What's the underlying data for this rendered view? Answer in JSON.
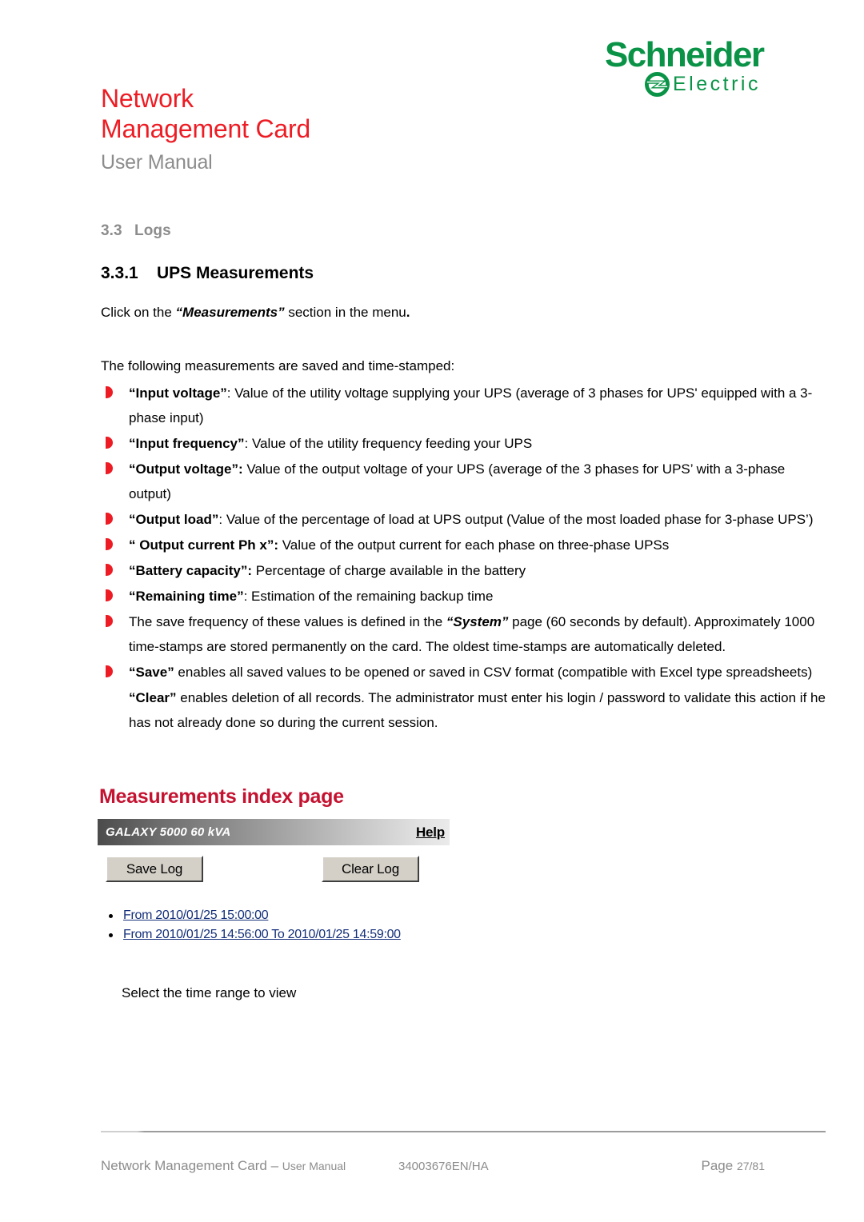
{
  "header": {
    "title_line1": "Network",
    "title_line2": "Management Card",
    "subtitle": "User Manual",
    "logo": {
      "wordmark": "Schneider",
      "subword": "Electric",
      "green": "#0A9347"
    },
    "title_color": "#ED1C24",
    "subtitle_color": "#8C8C8C"
  },
  "section": {
    "h2_number": "3.3",
    "h2_label": "Logs",
    "h3_number": "3.3.1",
    "h3_label": "UPS Measurements",
    "click_prefix": "Click on the ",
    "click_emphasis": "“Measurements”",
    "click_suffix": " section in the menu",
    "click_period": ".",
    "intro": "The following measurements are saved and time-stamped:"
  },
  "bullets": [
    {
      "bold": "“Input voltage”",
      "rest": ": Value of the utility voltage supplying your UPS (average of 3 phases for UPS' equipped with a 3-phase input)"
    },
    {
      "bold": "“Input frequency”",
      "rest": ": Value of the utility frequency feeding your UPS"
    },
    {
      "bold": "“Output voltage”:",
      "rest": " Value of the output voltage of your UPS (average of the 3 phases for UPS’ with a 3-phase output)"
    },
    {
      "bold": "“Output load”",
      "rest": ": Value of the percentage of load at UPS output (Value of the most loaded phase for 3-phase UPS’)"
    },
    {
      "bold": "“ Output current Ph x”:",
      "rest": " Value of the output current for each phase on three-phase UPSs"
    },
    {
      "bold": "“Battery capacity”:",
      "rest": " Percentage of charge available in the battery"
    },
    {
      "bold": "“Remaining time”",
      "rest": ": Estimation of the remaining backup time"
    }
  ],
  "system_bullet": {
    "pre": "The save frequency of these values is defined in the ",
    "emphasis": "“System”",
    "post": " page (60 seconds by default). Approximately 1000 time-stamps are stored permanently on the card. The oldest time-stamps are automatically deleted."
  },
  "save_bullet": {
    "bold": "“Save”",
    "rest": " enables all saved values to be opened or saved in CSV format (compatible with Excel type spreadsheets)"
  },
  "clear_paragraph": {
    "bold": "“Clear”",
    "rest": " enables deletion of all records. The administrator must enter his login / password to validate this action if he has not already done so during the current session."
  },
  "screenshot": {
    "title": "Measurements index page",
    "model": "GALAXY 5000 60 kVA",
    "help_label": "Help",
    "save_button": "Save Log",
    "clear_button": "Clear Log",
    "links": [
      "From 2010/01/25 15:00:00",
      "From 2010/01/25 14:56:00 To 2010/01/25 14:59:00"
    ],
    "link_color": "#15307A",
    "title_color": "#C41230"
  },
  "caption": "Select the time range to view",
  "footer": {
    "left_main": "Network Management Card",
    "left_dash": " – ",
    "left_small": "User Manual",
    "middle": "34003676EN/HA",
    "right_main": "Page ",
    "right_small": "27/81"
  }
}
